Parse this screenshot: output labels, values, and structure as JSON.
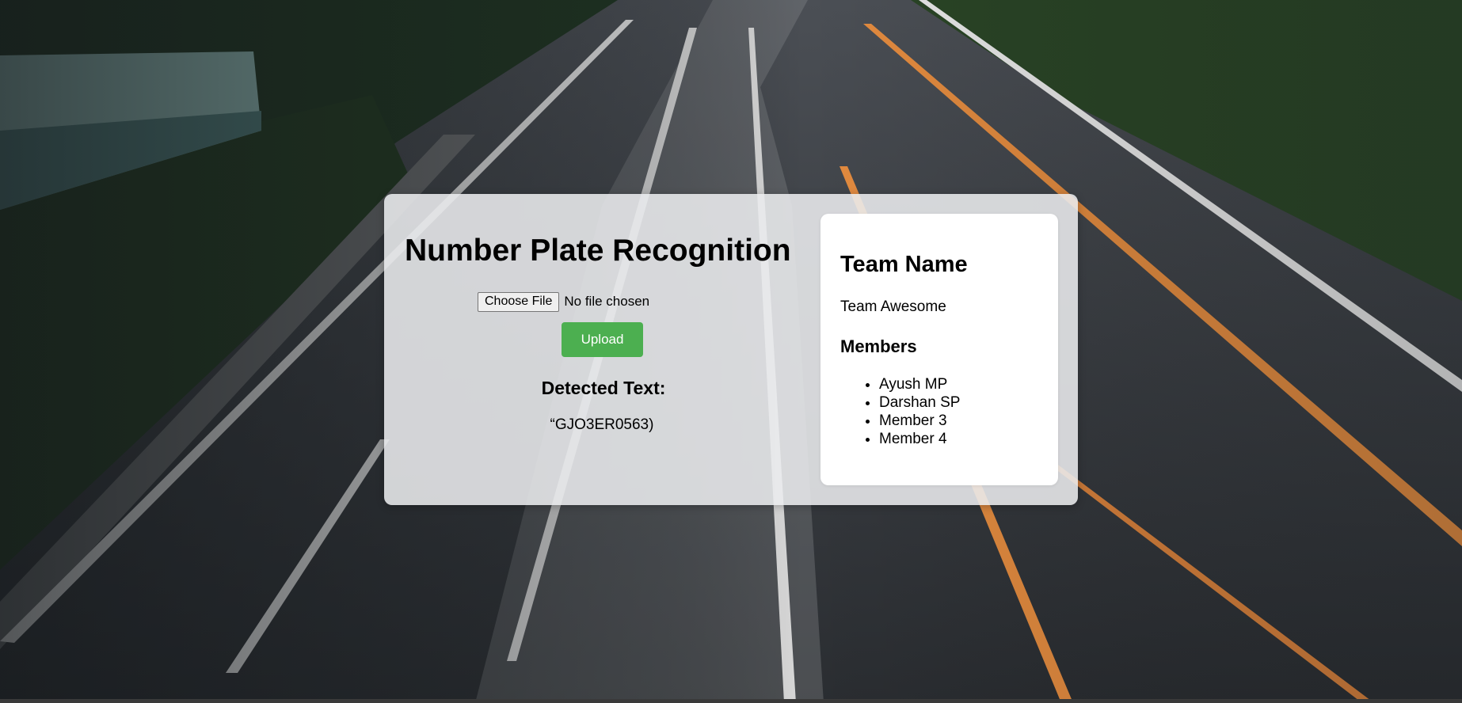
{
  "app": {
    "title": "Number Plate Recognition"
  },
  "upload": {
    "choose_file_label": "Choose File",
    "file_status": "No file chosen",
    "upload_label": "Upload"
  },
  "result": {
    "label": "Detected Text:",
    "value": "“GJO3ER0563)"
  },
  "team": {
    "heading": "Team Name",
    "name": "Team Awesome",
    "members_heading": "Members",
    "members": [
      "Ayush MP",
      "Darshan SP",
      "Member 3",
      "Member 4"
    ]
  },
  "colors": {
    "upload_button": "#4caf50",
    "panel_background": "#ebecee",
    "card_background": "#ffffff"
  }
}
